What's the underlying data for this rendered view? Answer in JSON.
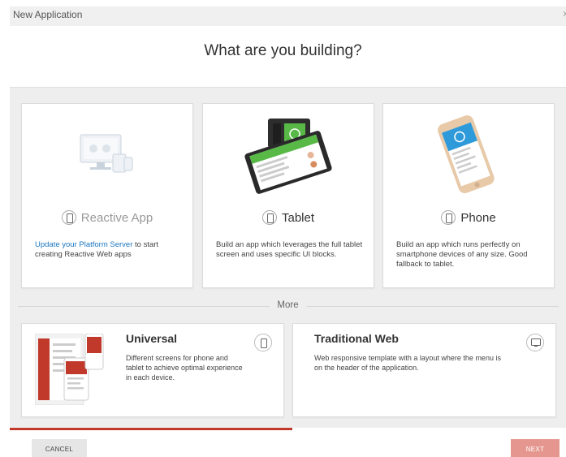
{
  "window": {
    "title": "New Application",
    "close_glyph": "x"
  },
  "heading": "What are you building?",
  "cards": {
    "reactive": {
      "title": "Reactive App",
      "link_text": "Update your Platform Server",
      "desc_rest": " to start creating Reactive Web apps",
      "icon": "reactive-devices-icon"
    },
    "tablet": {
      "title": "Tablet",
      "desc": "Build an app which leverages the full tablet screen and uses specific UI blocks.",
      "icon": "tablet-device-icon"
    },
    "phone": {
      "title": "Phone",
      "desc": "Build an app which runs perfectly on smartphone devices of any size. Good fallback to tablet.",
      "icon": "phone-device-icon"
    }
  },
  "more_label": "More",
  "bottom_cards": {
    "universal": {
      "title": "Universal",
      "desc": "Different screens for phone and tablet to achieve optimal experience in each device.",
      "icon": "phone-icon"
    },
    "traditional": {
      "title": "Traditional Web",
      "desc": "Web responsive template with a layout where the menu is on the header of the application.",
      "icon": "monitor-icon"
    }
  },
  "buttons": {
    "cancel": "CANCEL",
    "next": "NEXT"
  },
  "colors": {
    "accent": "#c0392b",
    "next_bg": "#e5978f",
    "link": "#1b76c0",
    "panel_bg": "#eeeeee"
  }
}
